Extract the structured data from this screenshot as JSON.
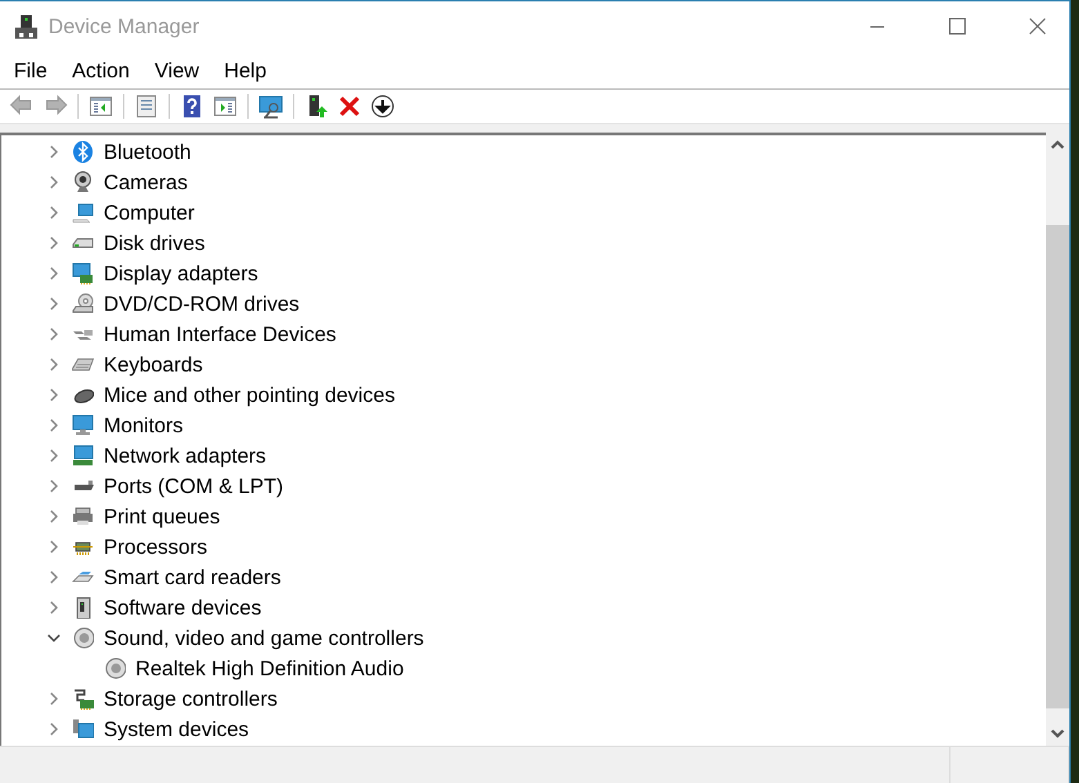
{
  "window": {
    "title": "Device Manager"
  },
  "menu": [
    "File",
    "Action",
    "View",
    "Help"
  ],
  "toolbar": [
    {
      "kind": "back",
      "disabled": true
    },
    {
      "kind": "forward",
      "disabled": true
    },
    {
      "kind": "sep"
    },
    {
      "kind": "console-tree"
    },
    {
      "kind": "sep"
    },
    {
      "kind": "properties"
    },
    {
      "kind": "sep"
    },
    {
      "kind": "help"
    },
    {
      "kind": "action-pane"
    },
    {
      "kind": "sep"
    },
    {
      "kind": "scan"
    },
    {
      "kind": "sep"
    },
    {
      "kind": "update"
    },
    {
      "kind": "uninstall"
    },
    {
      "kind": "disable"
    }
  ],
  "tree": [
    {
      "label": "Bluetooth",
      "kind": "bluetooth",
      "expanded": false
    },
    {
      "label": "Cameras",
      "kind": "camera",
      "expanded": false
    },
    {
      "label": "Computer",
      "kind": "computer",
      "expanded": false
    },
    {
      "label": "Disk drives",
      "kind": "disk",
      "expanded": false
    },
    {
      "label": "Display adapters",
      "kind": "display",
      "expanded": false
    },
    {
      "label": "DVD/CD-ROM drives",
      "kind": "dvd",
      "expanded": false
    },
    {
      "label": "Human Interface Devices",
      "kind": "hid",
      "expanded": false
    },
    {
      "label": "Keyboards",
      "kind": "keyboard",
      "expanded": false
    },
    {
      "label": "Mice and other pointing devices",
      "kind": "mouse",
      "expanded": false
    },
    {
      "label": "Monitors",
      "kind": "monitor",
      "expanded": false
    },
    {
      "label": "Network adapters",
      "kind": "network",
      "expanded": false
    },
    {
      "label": "Ports (COM & LPT)",
      "kind": "port",
      "expanded": false
    },
    {
      "label": "Print queues",
      "kind": "printer",
      "expanded": false
    },
    {
      "label": "Processors",
      "kind": "chip",
      "expanded": false
    },
    {
      "label": "Smart card readers",
      "kind": "card",
      "expanded": false
    },
    {
      "label": "Software devices",
      "kind": "software",
      "expanded": false
    },
    {
      "label": "Sound, video and game controllers",
      "kind": "speaker",
      "expanded": true,
      "children": [
        {
          "label": "Realtek High Definition Audio",
          "kind": "speaker"
        }
      ]
    },
    {
      "label": "Storage controllers",
      "kind": "storage",
      "expanded": false
    },
    {
      "label": "System devices",
      "kind": "system",
      "expanded": false
    }
  ]
}
